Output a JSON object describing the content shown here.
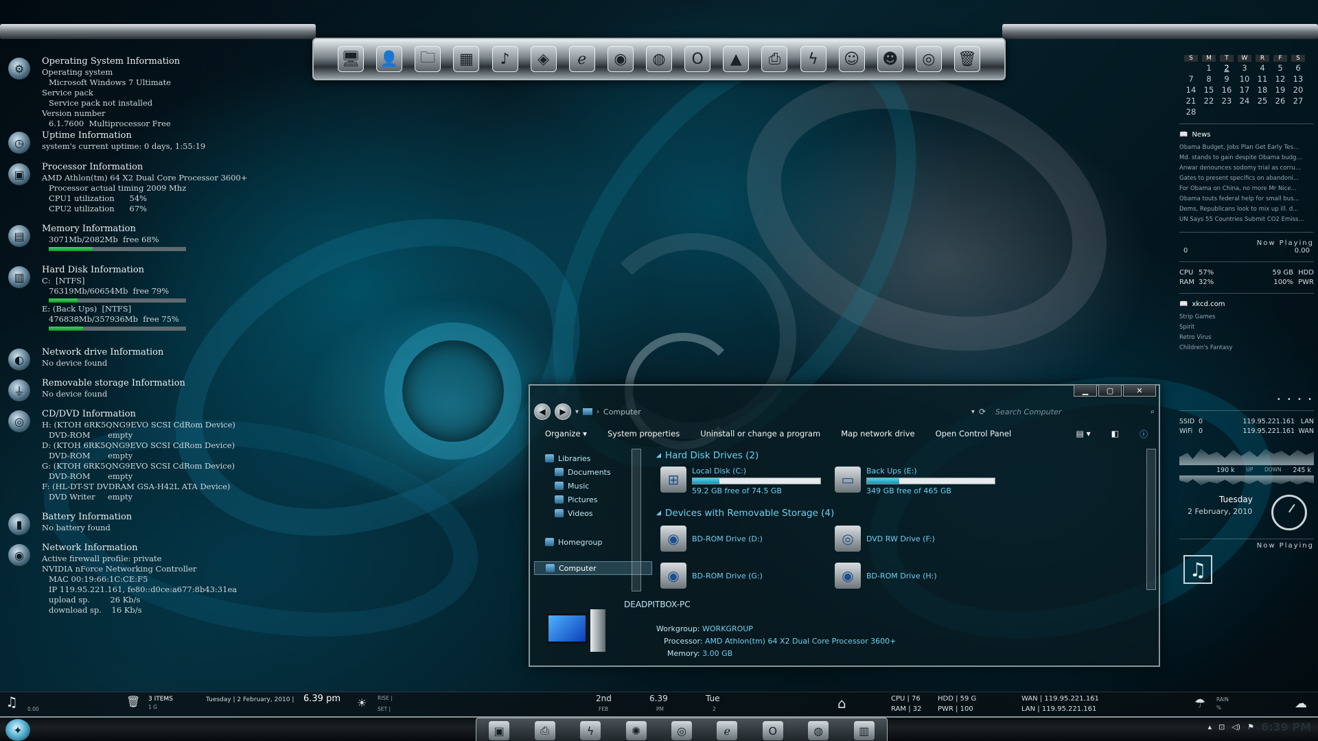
{
  "top_dock": {
    "icons": [
      "computer-icon",
      "user-folder-icon",
      "documents-icon",
      "calculator-icon",
      "music-note-icon",
      "disc-icon",
      "ie-icon",
      "firefox-icon",
      "chrome-icon",
      "opera-icon",
      "vlc-icon",
      "printer-icon",
      "winamp-icon",
      "messenger-icon",
      "people-icon",
      "eye-icon",
      "recycle-bin-icon"
    ]
  },
  "system_info": {
    "os": {
      "title": "Operating System Information",
      "os_label": "Operating system",
      "os_value": "Microsoft Windows 7 Ultimate",
      "sp_label": "Service pack",
      "sp_value": "Service pack not installed",
      "ver_label": "Version number",
      "ver_value": "6.1.7600  Multiprocessor Free"
    },
    "uptime": {
      "title": "Uptime Information",
      "value": "system's current uptime: 0 days, 1:55:19"
    },
    "processor": {
      "title": "Processor Information",
      "name": "AMD Athlon(tm) 64 X2 Dual Core Processor 3600+",
      "timing": "Processor actual timing 2009 Mhz",
      "cpu1": "CPU1 utilization      54%",
      "cpu2": "CPU2 utilization      67%"
    },
    "memory": {
      "title": "Memory Information",
      "value": "3071Mb/2082Mb  free 68%",
      "free_fraction": 0.32
    },
    "disk": {
      "title": "Hard Disk Information",
      "c_label": "C:  [NTFS]",
      "c_value": "76319Mb/60654Mb  free 79%",
      "c_used": 0.21,
      "e_label": "E: (Back Ups)  [NTFS]",
      "e_value": "476838Mb/357936Mb  free 75%",
      "e_used": 0.25
    },
    "network_drive": {
      "title": "Network drive Information",
      "value": "No device found"
    },
    "removable": {
      "title": "Removable storage Information",
      "value": "No device found"
    },
    "cdvd": {
      "title": "CD/DVD Information",
      "h": "H: (KTOH 6RK5QNG9EVO SCSI CdRom Device)",
      "h_s": "DVD-ROM       empty",
      "d": "D: (KTOH 6RK5QNG9EVO SCSI CdRom Device)",
      "d_s": "DVD-ROM       empty",
      "g": "G: (KTOH 6RK5QNG9EVO SCSI CdRom Device)",
      "g_s": "DVD-ROM       empty",
      "f": "F: (HL-DT-ST DVDRAM GSA-H42L ATA Device)",
      "f_s": "DVD Writer     empty"
    },
    "battery": {
      "title": "Battery Information",
      "value": "No battery found"
    },
    "network": {
      "title": "Network Information",
      "firewall": "Active firewall profile: private",
      "adapter": "NVIDIA nForce Networking Controller",
      "mac": "MAC 00:19:66:1C:CE:F5",
      "ip": "IP 119.95.221.161, fe80::d0ce:a677:8b43:31ea",
      "up": "upload sp.        26 Kb/s",
      "down": "download sp.    16 Kb/s"
    }
  },
  "calendar": {
    "headers": [
      "S",
      "M",
      "T",
      "W",
      "R",
      "F",
      "S"
    ],
    "rows": [
      [
        "",
        "1",
        "2",
        "3",
        "4",
        "5",
        "6"
      ],
      [
        "7",
        "8",
        "9",
        "10",
        "11",
        "12",
        "13"
      ],
      [
        "14",
        "15",
        "16",
        "17",
        "18",
        "19",
        "20"
      ],
      [
        "21",
        "22",
        "23",
        "24",
        "25",
        "26",
        "27"
      ],
      [
        "28",
        "",
        "",
        "",
        "",
        "",
        ""
      ]
    ],
    "today": "2"
  },
  "news": {
    "title": "News",
    "items": [
      "Obama Budget, Jobs Plan Get Early Tes...",
      "Md. stands to gain despite Obama budg...",
      "Anwar denounces sodomy trial as corru...",
      "Gates to present specifics on abandoni...",
      "For Obama on China, no more Mr Nice...",
      "Obama touts federal help for small bus...",
      "Dems, Republicans look to mix up ill. d...",
      "UN Says 55 Countries Submit CO2 Emiss..."
    ]
  },
  "now_playing": {
    "label": "Now Playing",
    "track": "0",
    "time": "0.00"
  },
  "stats": {
    "cpu_l": "CPU",
    "cpu": "57%",
    "ram_l": "RAM",
    "ram": "32%",
    "hdd_val": "59 GB",
    "pwr_val": "100%",
    "hdd_l": "HDD",
    "pwr_l": "PWR"
  },
  "xkcd": {
    "title": "xkcd.com",
    "items": [
      "Strip Games",
      "Spirit",
      "Retro Virus",
      "Children's Fantasy"
    ]
  },
  "network_widget": {
    "ssid_l": "SSID",
    "ssid_v": "0",
    "wifi_l": "WiFi",
    "wifi_v": "0",
    "ip1": "119.95.221.161",
    "ip2": "119.95.221.161",
    "lan_l": "LAN",
    "wan_l": "WAN",
    "up_val": "190 k",
    "up_l": "UP",
    "down_l": "DOWN",
    "down_val": "245 k"
  },
  "date_widget": {
    "day": "Tuesday",
    "date": "2 February, 2010"
  },
  "now_playing2": {
    "label": "Now Playing"
  },
  "explorer": {
    "path": "Computer",
    "search_placeholder": "Search Computer",
    "commands": [
      "Organize",
      "System properties",
      "Uninstall or change a program",
      "Map network drive",
      "Open Control Panel"
    ],
    "nav": {
      "libraries": "Libraries",
      "documents": "Documents",
      "music": "Music",
      "pictures": "Pictures",
      "videos": "Videos",
      "homegroup": "Homegroup",
      "computer": "Computer"
    },
    "hdd_group": "Hard Disk Drives (2)",
    "removable_group": "Devices with Removable Storage (4)",
    "drives": [
      {
        "name": "Local Disk (C:)",
        "free": "59.2 GB free of 74.5 GB",
        "used": 0.21
      },
      {
        "name": "Back Ups (E:)",
        "free": "349 GB free of 465 GB",
        "used": 0.25
      }
    ],
    "removables": [
      "BD-ROM Drive (D:)",
      "DVD RW Drive (F:)",
      "BD-ROM Drive (G:)",
      "BD-ROM Drive (H:)"
    ],
    "pc_name": "DEADPITBOX-PC",
    "workgroup_l": "Workgroup:",
    "workgroup": "WORKGROUP",
    "processor_l": "Processor:",
    "processor": "AMD Athlon(tm) 64 X2 Dual Core Processor 3600+",
    "memory_l": "Memory:",
    "memory": "3.00 GB"
  },
  "bottom": {
    "items_count": "3 ITEMS",
    "items_sub": "1 G",
    "date": "Tuesday | 2 February, 2010 |",
    "time": "6.39 pm",
    "rise": "RISE  |",
    "set": "SET  |",
    "d1": "2nd",
    "d1s": "FEB",
    "d2": "6.39",
    "d2s": "PM",
    "d3": "Tue",
    "d3s": "2",
    "cpu": "CPU | 76",
    "ram": "RAM | 32",
    "hdd": "HDD | 59 G",
    "pwr": "PWR | 100",
    "wan": "WAN |  119.95.221.161",
    "lan": "LAN |  119.95.221.161",
    "rain": "RAIN",
    "rain_pct": "%",
    "music_time": "0.00"
  },
  "tray": {
    "clock": "6:39 PM"
  }
}
